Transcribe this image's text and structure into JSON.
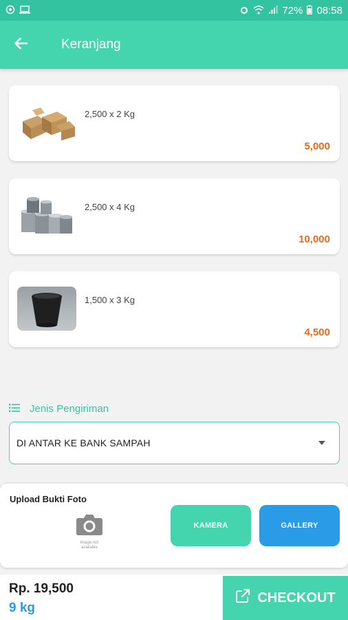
{
  "status_bar": {
    "battery": "72%",
    "time": "08:58"
  },
  "app_bar": {
    "title": "Keranjang"
  },
  "cart": {
    "items": [
      {
        "qty_text": "2,500 x 2 Kg",
        "price": "5,000",
        "image": "cardboard-boxes"
      },
      {
        "qty_text": "2,500 x 4 Kg",
        "price": "10,000",
        "image": "metal-cans"
      },
      {
        "qty_text": "1,500 x 3 Kg",
        "price": "4,500",
        "image": "plastic-pot"
      }
    ]
  },
  "shipping": {
    "label": "Jenis Pengiriman",
    "selected": "DI ANTAR KE BANK SAMPAH"
  },
  "upload": {
    "title": "Upload Bukti Foto",
    "placeholder_text": "image not available",
    "camera_button": "KAMERA",
    "gallery_button": "GALLERY"
  },
  "summary": {
    "total": "Rp. 19,500",
    "weight": "9 kg",
    "checkout_label": "CHECKOUT"
  },
  "colors": {
    "primary": "#44d4ae",
    "status_bar": "#33c3a1",
    "accent_blue": "#2a9be6",
    "price_orange": "#e86a1c"
  }
}
